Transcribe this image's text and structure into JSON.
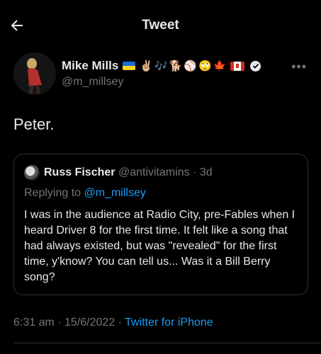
{
  "header": {
    "title": "Tweet"
  },
  "author": {
    "display_name": "Mike Mills",
    "emojis": [
      "✌🏼",
      "🎶",
      "🐕",
      "⚾",
      "🙄",
      "🍁"
    ],
    "handle": "@m_millsey"
  },
  "tweet": {
    "text": "Peter."
  },
  "quote": {
    "author_name": "Russ Fischer",
    "author_handle": "@antivitamins",
    "age": "3d",
    "replying_prefix": "Replying to ",
    "replying_to": "@m_millsey",
    "body": "I was in the audience at Radio City, pre-Fables when I heard Driver 8 for the first time.  It felt like a song that had always existed, but was \"revealed\" for the first time, y'know?  You can tell us... Was it a Bill Berry song?"
  },
  "meta": {
    "time": "6:31 am",
    "date": "15/6/2022",
    "source": "Twitter for iPhone",
    "sep": " · "
  },
  "colors": {
    "background": "#000000",
    "text": "#e7e9ea",
    "muted": "#71767b",
    "link": "#1d9bf0",
    "border": "#2f3336"
  }
}
